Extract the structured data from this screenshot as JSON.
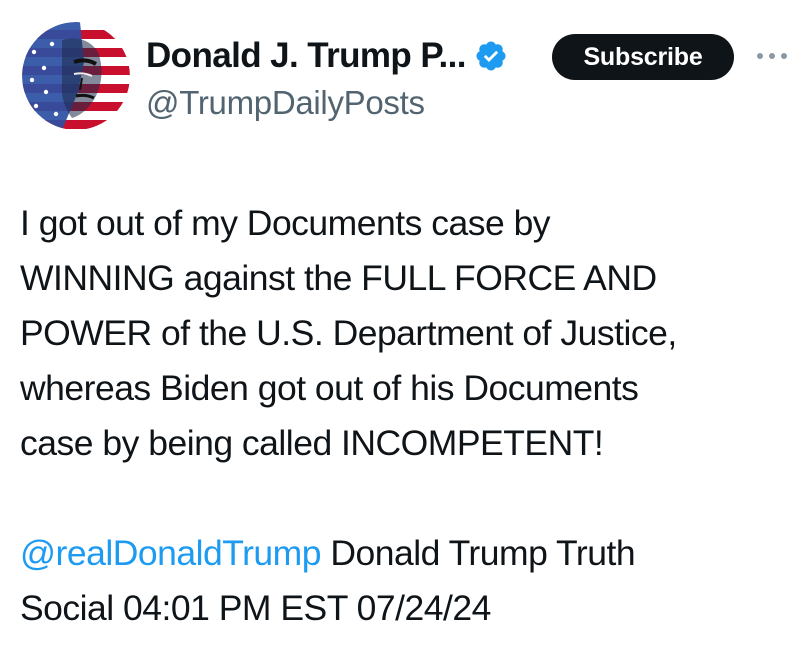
{
  "author": {
    "display_name": "Donald J. Trump P...",
    "handle": "@TrumpDailyPosts",
    "avatar_icon": "american-flag-portrait-avatar",
    "verified_icon": "verified-badge-icon",
    "verified_color": "#1d9bf0"
  },
  "actions": {
    "subscribe_label": "Subscribe",
    "more_icon": "more-options-icon"
  },
  "tweet": {
    "lines": [
      "I got out of my Documents case by",
      "WINNING against the FULL FORCE AND",
      "POWER of the U.S. Department of Justice,",
      "whereas Biden got out of his Documents",
      "case by being called INCOMPETENT!"
    ],
    "mention": "@realDonaldTrump",
    "source_line_1_rest": " Donald Trump Truth",
    "source_line_2": "Social 04:01 PM EST 07/24/24"
  },
  "colors": {
    "text": "#0f1419",
    "secondary_text": "#536471",
    "link": "#1d9bf0",
    "button_bg": "#0f1419",
    "button_text": "#ffffff"
  }
}
